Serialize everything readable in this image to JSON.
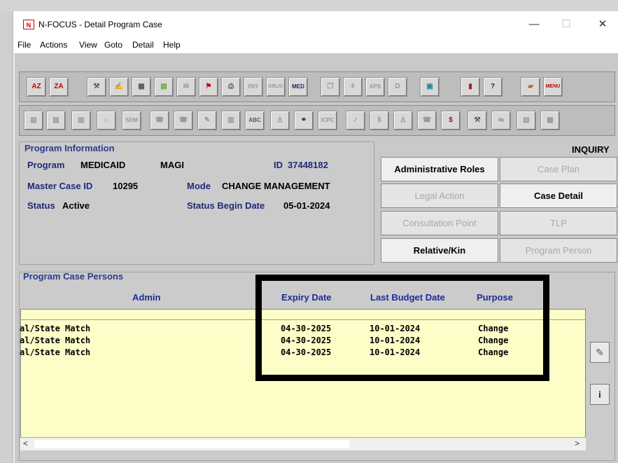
{
  "window": {
    "app_icon": "N",
    "title": "N-FOCUS - Detail Program Case",
    "controls": {
      "minimize": "—",
      "maximize": "☐",
      "close": "✕"
    }
  },
  "menu": [
    "File",
    "Actions",
    "View",
    "Goto",
    "Detail",
    "Help"
  ],
  "toolbar": {
    "row1_icons": [
      "sort-az-icon",
      "sort-za-icon",
      "tools-icon",
      "signature-icon",
      "calendar-icon",
      "notebook-icon",
      "paper-icon",
      "flag-icon",
      "print-icon",
      "pay-icon",
      "obligation-icon",
      "med-icon",
      "copy-icon",
      "people-icon",
      "aps-icon",
      "document-icon",
      "monitor-icon",
      "chart-icon",
      "help-icon",
      "folder-icon",
      "menu-icon"
    ],
    "row1_labels": {
      "pay": "PAY",
      "obligation": "OBLIG",
      "med": "MED",
      "aps": "APS",
      "menu": "MENU"
    },
    "row2_icons": [
      "icon-a",
      "icon-b",
      "icon-c",
      "building-icon",
      "sdm-icon",
      "phone-icon",
      "phone-icon-2",
      "form-icon",
      "report-icon",
      "abc-icon",
      "family-icon",
      "handshake-icon",
      "icpc-icon",
      "split-icon",
      "money-icon",
      "person-icon",
      "phone-icon-3",
      "dollar-icon",
      "tools-icon-2",
      "merge-icon",
      "list-icon",
      "grid-icon"
    ],
    "row2_labels": {
      "sdm": "SDM",
      "icpc": "ICPC",
      "dollar": "$"
    }
  },
  "program_info": {
    "section_title": "Program Information",
    "program_label": "Program",
    "program_value": "MEDICAID",
    "program_type": "MAGI",
    "id_label": "ID",
    "id_value": "37448182",
    "master_case_label": "Master Case ID",
    "master_case_value": "10295",
    "mode_label": "Mode",
    "mode_value": "CHANGE MANAGEMENT",
    "status_label": "Status",
    "status_value": "Active",
    "status_begin_label": "Status Begin Date",
    "status_begin_value": "05-01-2024"
  },
  "inquiry_label": "INQUIRY",
  "buttons": {
    "administrative_roles": "Administrative Roles",
    "case_plan": "Case Plan",
    "legal_action": "Legal Action",
    "case_detail": "Case Detail",
    "consultation_point": "Consultation Point",
    "tlp": "TLP",
    "relative_kin": "Relative/Kin",
    "program_person": "Program Person"
  },
  "persons": {
    "section_title": "Program Case Persons",
    "columns": {
      "admin": "Admin",
      "expiry": "Expiry Date",
      "budget": "Last Budget Date",
      "purpose": "Purpose"
    },
    "rows": [
      {
        "admin": "al/State Match",
        "expiry": "04-30-2025",
        "budget": "10-01-2024",
        "purpose": "Change"
      },
      {
        "admin": "al/State Match",
        "expiry": "04-30-2025",
        "budget": "10-01-2024",
        "purpose": "Change"
      },
      {
        "admin": "al/State Match",
        "expiry": "04-30-2025",
        "budget": "10-01-2024",
        "purpose": "Change"
      }
    ],
    "scroll_left": "<",
    "scroll_right": ">"
  },
  "side_buttons": {
    "edit": "✎",
    "info": "i"
  }
}
